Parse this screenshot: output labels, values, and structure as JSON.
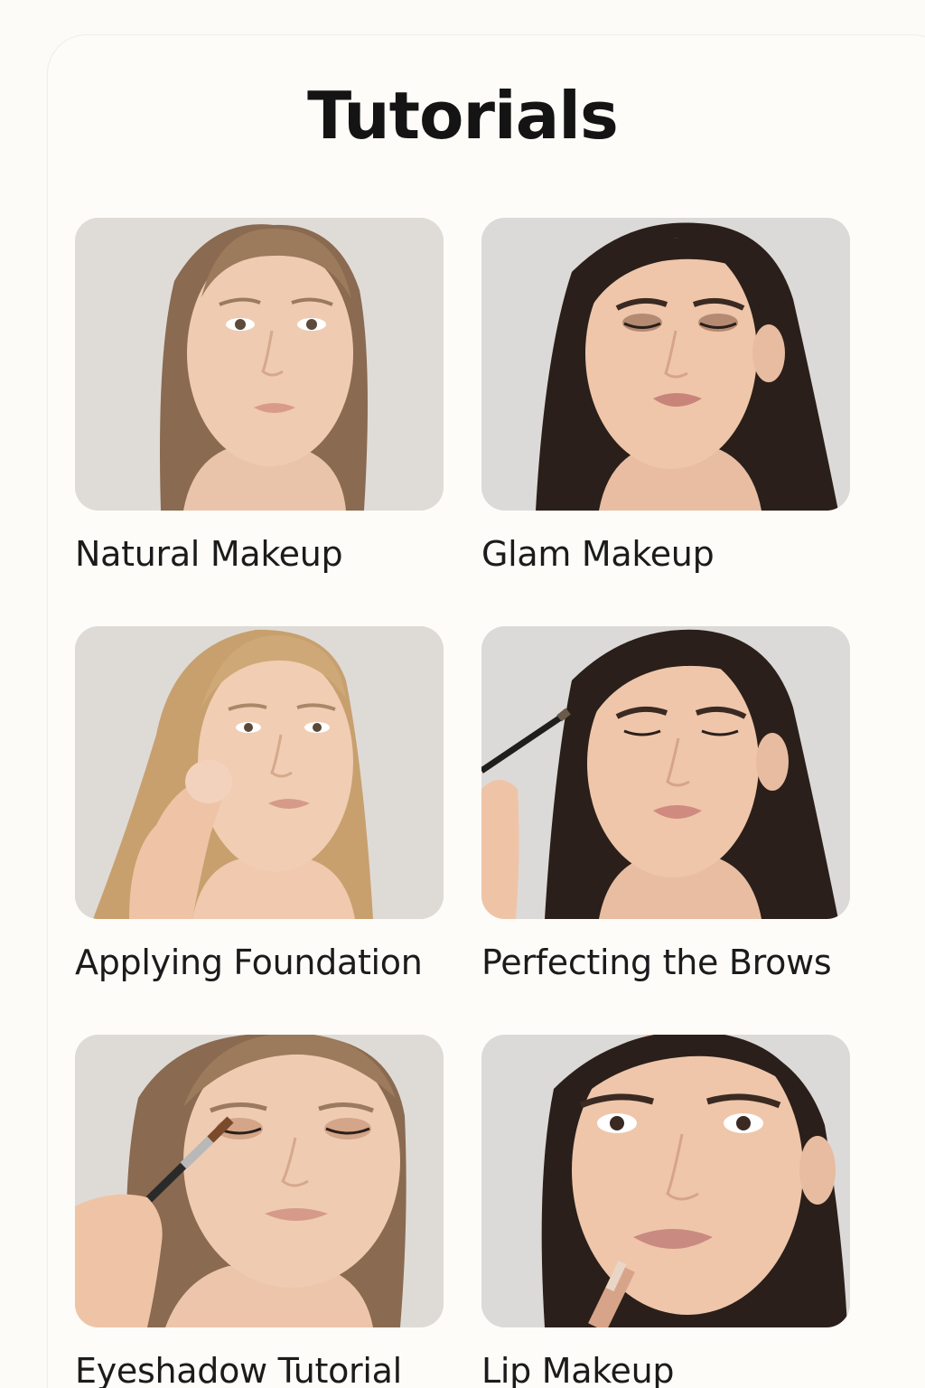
{
  "page": {
    "title": "Tutorials"
  },
  "tutorials": [
    {
      "label": "Natural Makeup",
      "thumbnail_icon": "portrait-natural-makeup"
    },
    {
      "label": "Glam Makeup",
      "thumbnail_icon": "portrait-glam-makeup"
    },
    {
      "label": "Applying Foundation",
      "thumbnail_icon": "portrait-foundation-sponge"
    },
    {
      "label": "Perfecting the Brows",
      "thumbnail_icon": "portrait-brow-brush"
    },
    {
      "label": "Eyeshadow Tutorial",
      "thumbnail_icon": "portrait-eyeshadow-brush"
    },
    {
      "label": "Lip Makeup",
      "thumbnail_icon": "portrait-lip-gloss"
    }
  ],
  "colors": {
    "background": "#fcfbf8",
    "thumbnail_background": "#dedcd8",
    "skin": "#eec7ad",
    "text": "#1b1b1b"
  }
}
